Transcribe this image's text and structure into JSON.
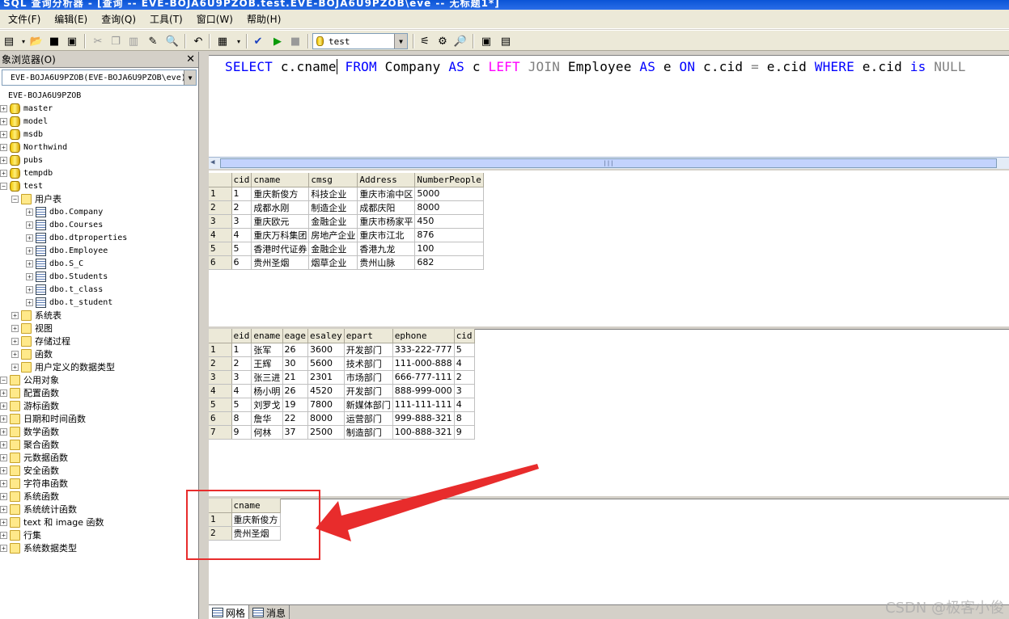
{
  "window": {
    "title": "SQL 查询分析器 - [查询 -- EVE-BOJA6U9PZOB.test.EVE-BOJA6U9PZOB\\eve -- 无标题1*]"
  },
  "menu": [
    "文件(F)",
    "编辑(E)",
    "查询(Q)",
    "工具(T)",
    "窗口(W)",
    "帮助(H)"
  ],
  "toolbar": {
    "database": "test"
  },
  "object_browser": {
    "title": "象浏览器(O)",
    "server": "EVE-BOJA6U9PZOB(EVE-BOJA6U9PZOB\\eve)",
    "root": "EVE-BOJA6U9PZOB",
    "databases": [
      "master",
      "model",
      "msdb",
      "Northwind",
      "pubs",
      "tempdb",
      "test"
    ],
    "test_folders": {
      "user_tables_label": "用户表",
      "tables": [
        "dbo.Company",
        "dbo.Courses",
        "dbo.dtproperties",
        "dbo.Employee",
        "dbo.S_C",
        "dbo.Students",
        "dbo.t_class",
        "dbo.t_student"
      ],
      "other": [
        "系统表",
        "视图",
        "存储过程",
        "函数",
        "用户定义的数据类型"
      ]
    },
    "public_objects": {
      "label": "公用对象",
      "items": [
        "配置函数",
        "游标函数",
        "日期和时间函数",
        "数学函数",
        "聚合函数",
        "元数据函数",
        "安全函数",
        "字符串函数",
        "系统函数",
        "系统统计函数",
        "text 和 image 函数",
        "行集",
        "系统数据类型"
      ]
    }
  },
  "editor": {
    "sql_tokens": [
      {
        "t": "SELECT",
        "c": "kw"
      },
      {
        "t": " c.cname",
        "c": ""
      },
      {
        "t": "|",
        "c": "caret"
      },
      {
        "t": " FROM",
        "c": "kw"
      },
      {
        "t": " Company ",
        "c": ""
      },
      {
        "t": "AS",
        "c": "kw"
      },
      {
        "t": " c ",
        "c": ""
      },
      {
        "t": "LEFT",
        "c": "kw2"
      },
      {
        "t": " ",
        "c": ""
      },
      {
        "t": "JOIN",
        "c": "op"
      },
      {
        "t": " Employee ",
        "c": ""
      },
      {
        "t": "AS",
        "c": "kw"
      },
      {
        "t": " e ",
        "c": ""
      },
      {
        "t": "ON",
        "c": "kw"
      },
      {
        "t": " c.cid ",
        "c": ""
      },
      {
        "t": "=",
        "c": "op"
      },
      {
        "t": " e.cid ",
        "c": ""
      },
      {
        "t": "WHERE",
        "c": "kw"
      },
      {
        "t": " e.cid ",
        "c": ""
      },
      {
        "t": "is",
        "c": "kw"
      },
      {
        "t": " ",
        "c": ""
      },
      {
        "t": "NULL",
        "c": "op"
      }
    ]
  },
  "results": [
    {
      "columns": [
        "cid",
        "cname",
        "cmsg",
        "Address",
        "NumberPeople"
      ],
      "rows": [
        [
          "1",
          "1",
          "重庆新俊方",
          "科技企业",
          "重庆市渝中区",
          "5000"
        ],
        [
          "2",
          "2",
          "成都水刚",
          "制造企业",
          "成都庆阳",
          "8000"
        ],
        [
          "3",
          "3",
          "重庆欧元",
          "金融企业",
          "重庆市杨家平",
          "450"
        ],
        [
          "4",
          "4",
          "重庆万科集团",
          "房地产企业",
          "重庆市江北",
          "876"
        ],
        [
          "5",
          "5",
          "香港时代证券",
          "金融企业",
          "香港九龙",
          "100"
        ],
        [
          "6",
          "6",
          "贵州圣烟",
          "烟草企业",
          "贵州山脉",
          "682"
        ]
      ]
    },
    {
      "columns": [
        "eid",
        "ename",
        "eage",
        "esaley",
        "epart",
        "ephone",
        "cid"
      ],
      "rows": [
        [
          "1",
          "1",
          "张军",
          "26",
          "3600",
          "开发部门",
          "333-222-777",
          "5"
        ],
        [
          "2",
          "2",
          "王辉",
          "30",
          "5600",
          "技术部门",
          "111-000-888",
          "4"
        ],
        [
          "3",
          "3",
          "张三进",
          "21",
          "2301",
          "市场部门",
          "666-777-111",
          "2"
        ],
        [
          "4",
          "4",
          "杨小明",
          "26",
          "4520",
          "开发部门",
          "888-999-000",
          "3"
        ],
        [
          "5",
          "5",
          "刘罗戈",
          "19",
          "7800",
          "新媒体部门",
          "111-111-111",
          "4"
        ],
        [
          "6",
          "8",
          "詹华",
          "22",
          "8000",
          "运营部门",
          "999-888-321",
          "8"
        ],
        [
          "7",
          "9",
          "何林",
          "37",
          "2500",
          "制造部门",
          "100-888-321",
          "9"
        ]
      ]
    },
    {
      "columns": [
        "cname"
      ],
      "rows": [
        [
          "1",
          "重庆新俊方"
        ],
        [
          "2",
          "贵州圣烟"
        ]
      ]
    }
  ],
  "tabs": [
    "网格",
    "消息"
  ],
  "watermark": "CSDN @极客小俊",
  "colors": {
    "annotation": "#e82c2c"
  }
}
